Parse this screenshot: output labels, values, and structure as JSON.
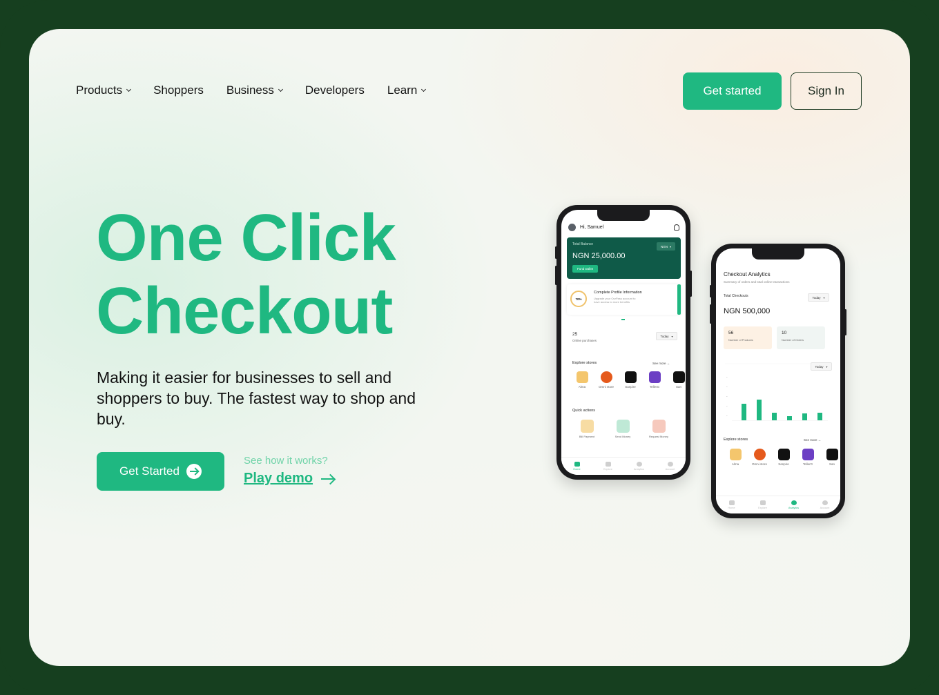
{
  "nav": {
    "items": [
      {
        "label": "Products",
        "dropdown": true
      },
      {
        "label": "Shoppers",
        "dropdown": false
      },
      {
        "label": "Business",
        "dropdown": true
      },
      {
        "label": "Developers",
        "dropdown": false
      },
      {
        "label": "Learn",
        "dropdown": true
      }
    ],
    "get_started": "Get started",
    "sign_in": "Sign In"
  },
  "hero": {
    "title_line1": "One Click",
    "title_line2": "Checkout",
    "subtitle": "Making it easier for businesses to sell and shoppers to buy. The fastest way to shop and buy.",
    "cta": "Get Started",
    "see_how": "See how it works?",
    "play_demo": "Play demo"
  },
  "colors": {
    "brand": "#1fb881",
    "frame": "#163f1f",
    "card_dark": "#0f5a48"
  },
  "phone1": {
    "greeting": "Hi, Samuel",
    "balance_label": "Total Balance",
    "currency": "NGN",
    "balance": "NGN 25,000.00",
    "fund_wallet": "Fund wallet",
    "profile_percent": "70%",
    "profile_title": "Complete Profile Information",
    "profile_desc": "Upgrade your OurPass account to have access to more benefits",
    "purchases_count": "25",
    "purchases_label": "Online purchases",
    "period": "Today",
    "explore_title": "Explore stores",
    "see_more": "See more",
    "stores": [
      {
        "label": "Alma",
        "color": "#f4c66d",
        "icon": "alma-logo-icon"
      },
      {
        "label": "Omni store",
        "color": "#e55a1c",
        "icon": "omni-logo-icon"
      },
      {
        "label": "Sanpire",
        "color": "#111111",
        "icon": "sanpire-logo-icon"
      },
      {
        "label": "TellerG",
        "color": "#6c3fc4",
        "icon": "tellerg-logo-icon"
      },
      {
        "label": "San",
        "color": "#111111",
        "icon": "san-logo-icon"
      }
    ],
    "quick_title": "Quick actions",
    "quick_actions": [
      {
        "label": "Bill Payment",
        "color": "#f7dca3"
      },
      {
        "label": "Send Money",
        "color": "#bfe9d6"
      },
      {
        "label": "Request Money",
        "color": "#f6c9bd"
      }
    ],
    "tabs": [
      "Home",
      "Explore",
      "Analytics",
      "Account"
    ],
    "active_tab": "Home"
  },
  "phone2": {
    "title": "Checkout Analytics",
    "subtitle": "Summary of orders and total online transactions",
    "total_label": "Total Checkouts",
    "period": "Today",
    "total": "NGN 500,000",
    "stats": [
      {
        "value": "56",
        "label": "Number of Products",
        "color": "#fdf1e4"
      },
      {
        "value": "10",
        "label": "Number of Orders",
        "color": "#f0f5f3"
      }
    ],
    "chart_period": "Today",
    "explore_title": "Explore stores",
    "see_more": "See more",
    "stores": [
      {
        "label": "Alma",
        "color": "#f4c66d",
        "icon": "alma-logo-icon"
      },
      {
        "label": "Omni store",
        "color": "#e55a1c",
        "icon": "omni-logo-icon"
      },
      {
        "label": "Sanpire",
        "color": "#111111",
        "icon": "sanpire-logo-icon"
      },
      {
        "label": "TellerG",
        "color": "#6c3fc4",
        "icon": "tellerg-logo-icon"
      },
      {
        "label": "San",
        "color": "#111111",
        "icon": "san-logo-icon"
      }
    ],
    "tabs": [
      "Home",
      "Explore",
      "Analytics",
      "Account"
    ],
    "active_tab": "Analytics"
  }
}
